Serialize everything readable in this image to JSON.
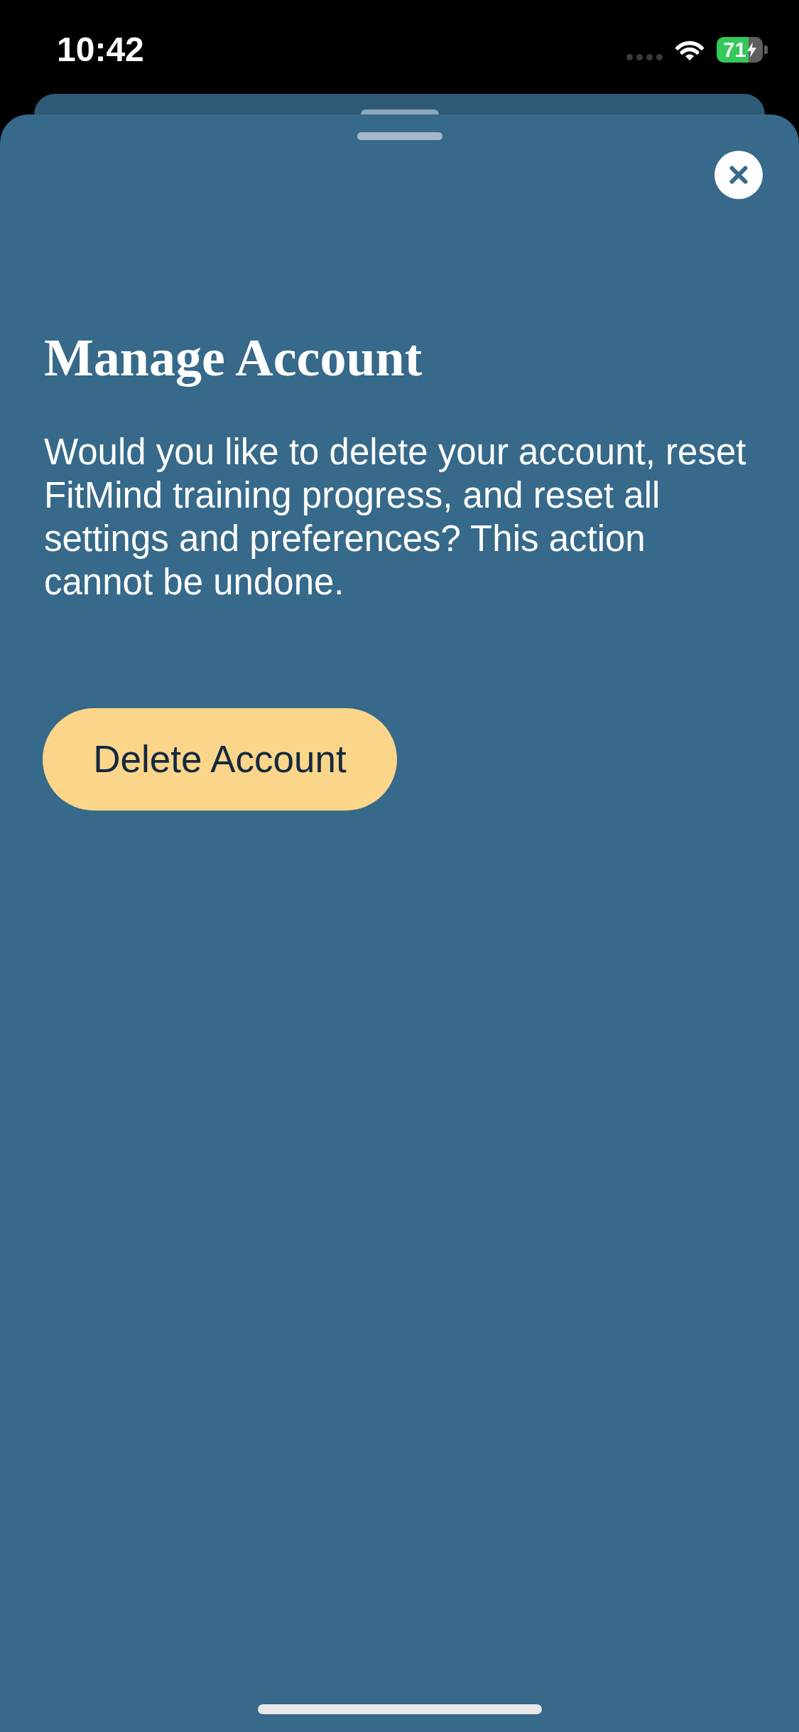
{
  "status_bar": {
    "time": "10:42",
    "battery": "71"
  },
  "sheet": {
    "title": "Manage Account",
    "message": "Would you like to delete your account, reset FitMind training progress, and reset all settings and preferences? This action cannot be undone.",
    "primary_button": {
      "label": "Delete Account"
    }
  }
}
